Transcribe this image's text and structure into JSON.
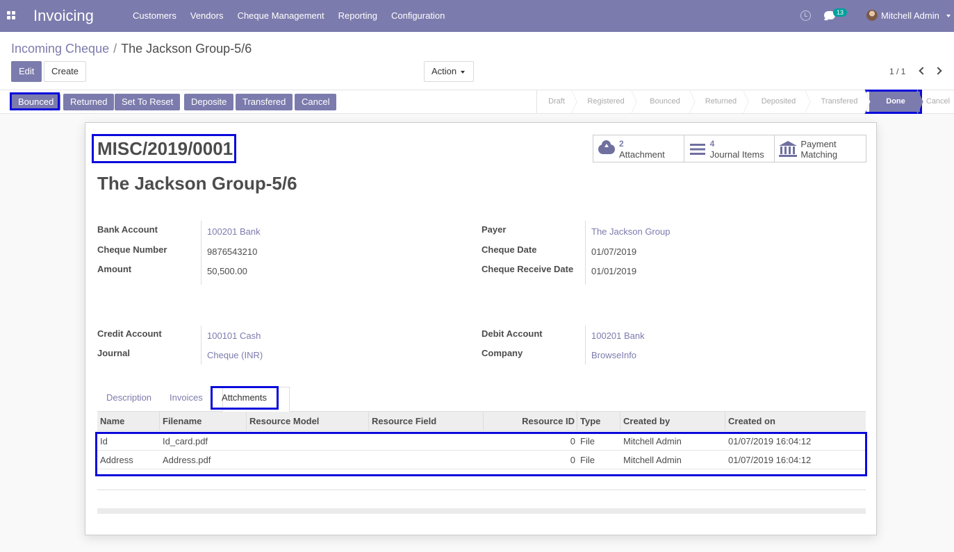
{
  "app": {
    "name": "Invoicing"
  },
  "nav": {
    "menu": [
      "Customers",
      "Vendors",
      "Cheque Management",
      "Reporting",
      "Configuration"
    ],
    "chat_count": "13",
    "user": "Mitchell Admin"
  },
  "breadcrumb": {
    "parent": "Incoming Cheque",
    "separator": "/",
    "current": "The Jackson Group-5/6"
  },
  "control": {
    "edit": "Edit",
    "create": "Create",
    "action": "Action",
    "pager": "1 / 1"
  },
  "status_buttons": [
    "Bounced",
    "Returned",
    "Set To Reset",
    "Deposite",
    "Transfered",
    "Cancel"
  ],
  "stages": [
    "Draft",
    "Registered",
    "Bounced",
    "Returned",
    "Deposited",
    "Transfered",
    "Done",
    "Cancel"
  ],
  "active_stage": "Done",
  "smart_buttons": [
    {
      "value": "2",
      "label": "Attachment",
      "icon": "cloud-upload-icon"
    },
    {
      "value": "4",
      "label": "Journal Items",
      "icon": "list-icon"
    },
    {
      "label_line1": "Payment",
      "label_line2": "Matching",
      "icon": "bank-icon"
    }
  ],
  "record": {
    "reference": "MISC/2019/0001",
    "title": "The Jackson Group-5/6",
    "bank_account": {
      "label": "Bank Account",
      "value": "100201 Bank"
    },
    "cheque_number": {
      "label": "Cheque Number",
      "value": "9876543210"
    },
    "amount": {
      "label": "Amount",
      "value": "50,500.00"
    },
    "payer": {
      "label": "Payer",
      "value": "The Jackson Group"
    },
    "cheque_date": {
      "label": "Cheque Date",
      "value": "01/07/2019"
    },
    "cheque_receive_date": {
      "label": "Cheque Receive Date",
      "value": "01/01/2019"
    },
    "credit_account": {
      "label": "Credit Account",
      "value": "100101 Cash"
    },
    "journal": {
      "label": "Journal",
      "value": "Cheque (INR)"
    },
    "debit_account": {
      "label": "Debit Account",
      "value": "100201 Bank"
    },
    "company": {
      "label": "Company",
      "value": "BrowseInfo"
    }
  },
  "tabs": [
    "Description",
    "Invoices",
    "Attchments"
  ],
  "attachments": {
    "columns": [
      "Name",
      "Filename",
      "Resource Model",
      "Resource Field",
      "Resource ID",
      "Type",
      "Created by",
      "Created on"
    ],
    "rows": [
      {
        "name": "Id",
        "filename": "Id_card.pdf",
        "resource_model": "",
        "resource_field": "",
        "resource_id": "0",
        "type": "File",
        "created_by": "Mitchell Admin",
        "created_on": "01/07/2019 16:04:12"
      },
      {
        "name": "Address",
        "filename": "Address.pdf",
        "resource_model": "",
        "resource_field": "",
        "resource_id": "0",
        "type": "File",
        "created_by": "Mitchell Admin",
        "created_on": "01/07/2019 16:04:12"
      }
    ]
  },
  "colors": {
    "primary": "#7c7bad",
    "highlight": "#0a0adb",
    "teal_badge": "#00a09d"
  }
}
